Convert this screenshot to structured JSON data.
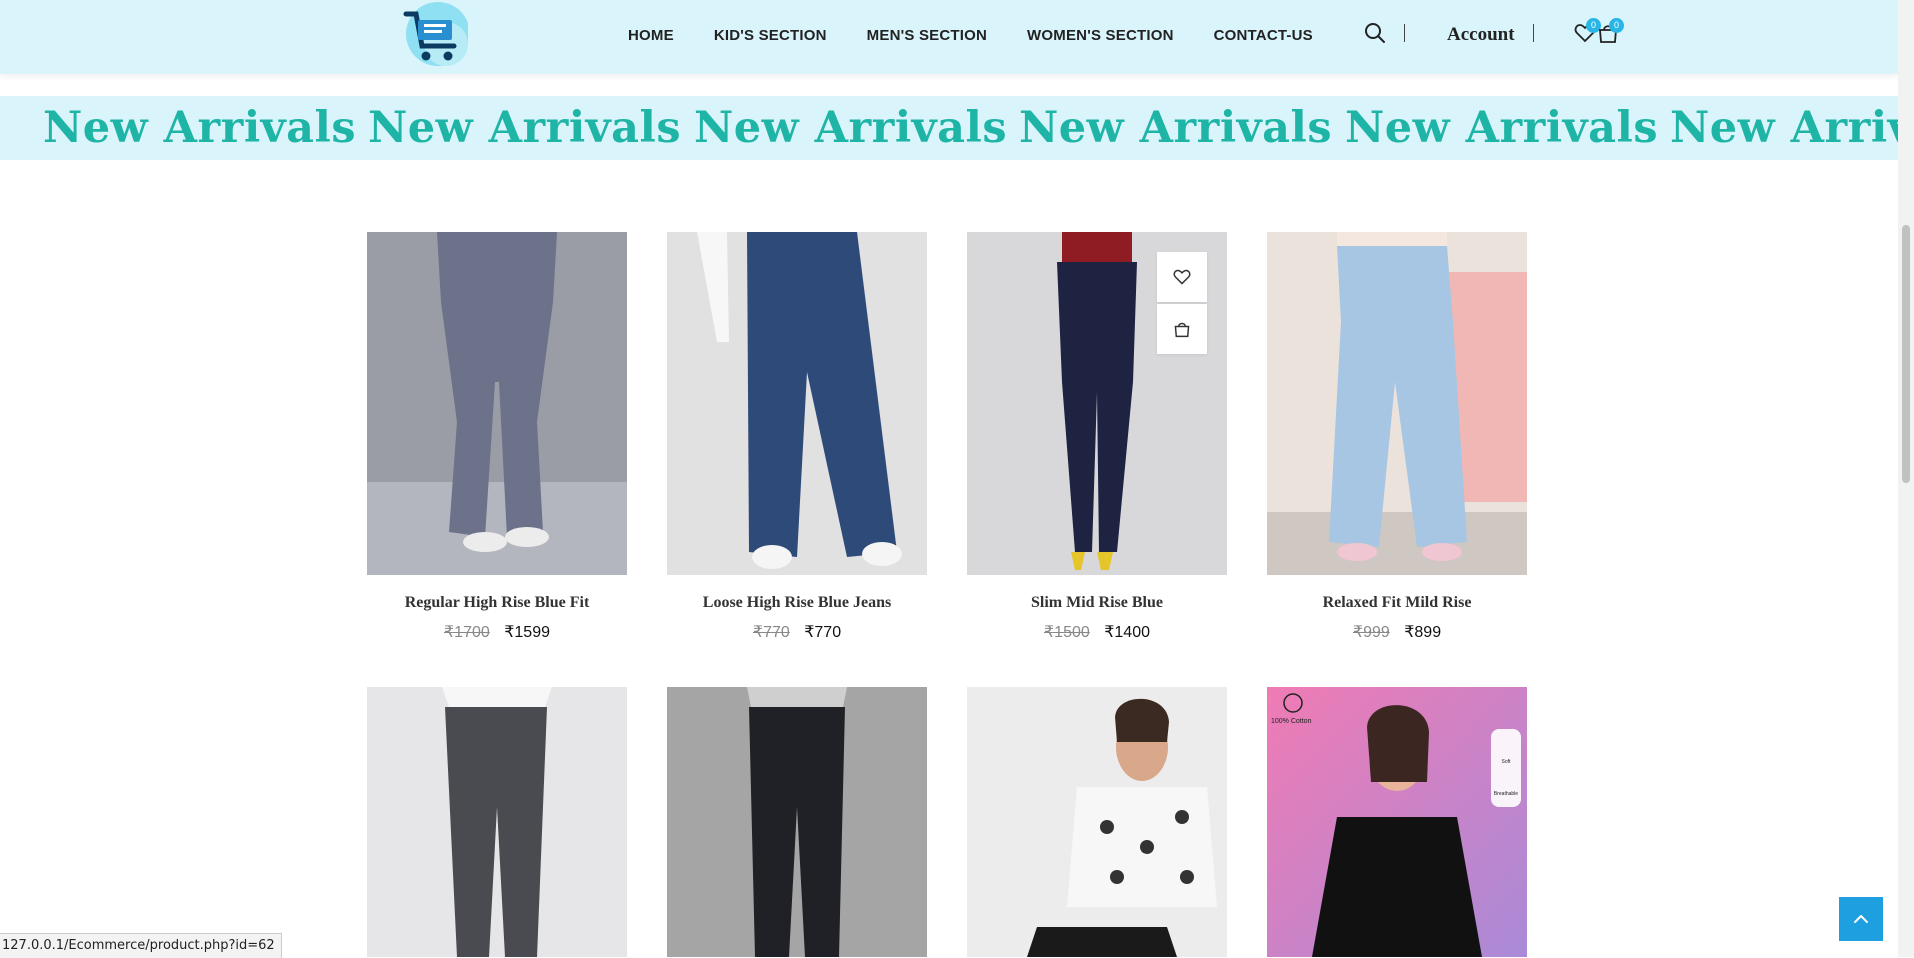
{
  "nav": {
    "items": [
      {
        "label": "HOME"
      },
      {
        "label": "KID'S SECTION"
      },
      {
        "label": "MEN'S SECTION"
      },
      {
        "label": "WOMEN'S SECTION"
      },
      {
        "label": "CONTACT-US"
      }
    ],
    "account_label": "Account",
    "wishlist_count": "0",
    "cart_count": "0"
  },
  "marquee": {
    "text": "New Arrivals"
  },
  "products": [
    {
      "name": "Regular High Rise Blue Fit",
      "old_price": "₹1700",
      "price": "₹1599",
      "image": "grey flared jeans"
    },
    {
      "name": "Loose High Rise Blue Jeans",
      "old_price": "₹770",
      "price": "₹770",
      "image": "dark wash wide jeans"
    },
    {
      "name": "Slim Mid Rise Blue",
      "old_price": "₹1500",
      "price": "₹1400",
      "image": "navy skinny jeans"
    },
    {
      "name": "Relaxed Fit Mild Rise",
      "old_price": "₹999",
      "price": "₹899",
      "image": "light blue wide jeans"
    }
  ],
  "second_row": [
    {
      "image": "charcoal acid wash jeans"
    },
    {
      "image": "black straight jeans"
    },
    {
      "image": "printed white t-shirt"
    },
    {
      "image": "black oversized t-shirt",
      "badge_text": "100% Cotton",
      "feature_soft": "Soft",
      "feature_breathable": "Breathable"
    }
  ],
  "status_url": "127.0.0.1/Ecommerce/product.php?id=62",
  "colors": {
    "header_bg": "#d9f4fb",
    "marquee_text": "#1fb5a6",
    "badge": "#29b6e6",
    "back_to_top": "#1e9fe0"
  }
}
